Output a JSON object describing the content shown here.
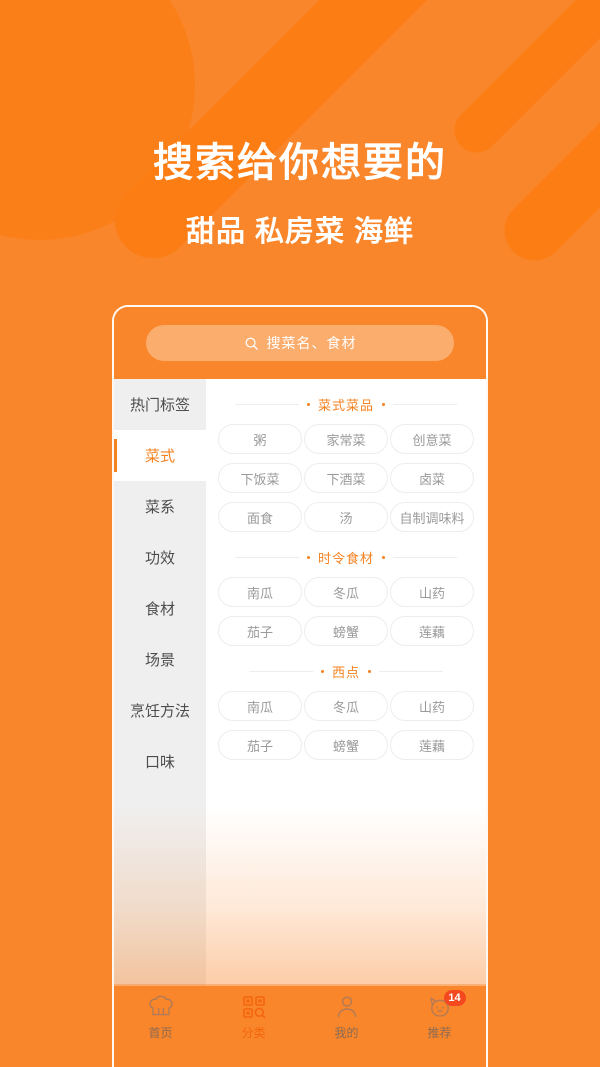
{
  "theme": {
    "brand_orange": "#f9862a",
    "accent_orange": "#f58220",
    "badge_red": "#f4481f",
    "chip_text": "#9a9a9a",
    "chip_border": "#ededed",
    "sidebar_bg": "#efefef"
  },
  "hero": {
    "title": "搜索给你想要的",
    "subtitle": "甜品 私房菜 海鲜"
  },
  "search": {
    "icon": "search-icon",
    "placeholder": "搜菜名、食材",
    "value": ""
  },
  "sidebar": {
    "items": [
      {
        "label": "热门标签",
        "active": false
      },
      {
        "label": "菜式",
        "active": true
      },
      {
        "label": "菜系",
        "active": false
      },
      {
        "label": "功效",
        "active": false
      },
      {
        "label": "食材",
        "active": false
      },
      {
        "label": "场景",
        "active": false
      },
      {
        "label": "烹饪方法",
        "active": false
      },
      {
        "label": "口味",
        "active": false
      }
    ]
  },
  "content": {
    "sections": [
      {
        "title": "菜式菜品",
        "rows": [
          [
            "粥",
            "家常菜",
            "创意菜"
          ],
          [
            "下饭菜",
            "下酒菜",
            "卤菜"
          ],
          [
            "面食",
            "汤",
            "自制调味料"
          ]
        ]
      },
      {
        "title": "时令食材",
        "rows": [
          [
            "南瓜",
            "冬瓜",
            "山药"
          ],
          [
            "茄子",
            "螃蟹",
            "莲藕"
          ]
        ]
      },
      {
        "title": "西点",
        "rows": [
          [
            "南瓜",
            "冬瓜",
            "山药"
          ],
          [
            "茄子",
            "螃蟹",
            "莲藕"
          ]
        ]
      }
    ]
  },
  "tabbar": {
    "items": [
      {
        "label": "首页",
        "icon": "chef-hat-icon",
        "active": false,
        "badge": ""
      },
      {
        "label": "分类",
        "icon": "grid-search-icon",
        "active": true,
        "badge": ""
      },
      {
        "label": "我的",
        "icon": "person-icon",
        "active": false,
        "badge": ""
      },
      {
        "label": "推荐",
        "icon": "cat-face-icon",
        "active": false,
        "badge": "14"
      }
    ]
  }
}
